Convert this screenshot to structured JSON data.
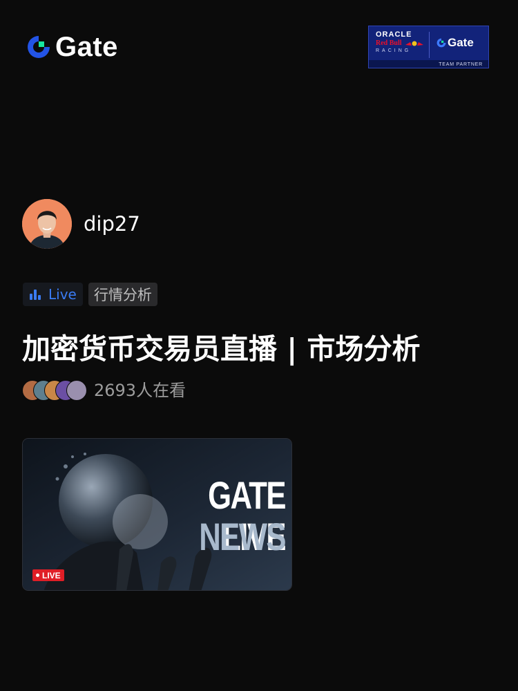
{
  "brand": {
    "name": "Gate",
    "accent": "#2354e6",
    "accent_green": "#17e5a0"
  },
  "partner_badge": {
    "oracle": "ORACLE",
    "redbull": "Red Bull",
    "racing": "RACING",
    "gate": "Gate",
    "partner": "TEAM PARTNER"
  },
  "streamer": {
    "username": "dip27"
  },
  "tags": {
    "live_label": "Live",
    "category": "行情分析",
    "live_icon": "bar-chart-icon"
  },
  "stream": {
    "title": "加密货币交易员直播 | 市场分析",
    "viewer_count": "2693人在看"
  },
  "thumbnail": {
    "headline_1": "GATE LIVE",
    "headline_2": "NEWS",
    "live_badge": "LIVE",
    "live_color": "#e01e26"
  }
}
